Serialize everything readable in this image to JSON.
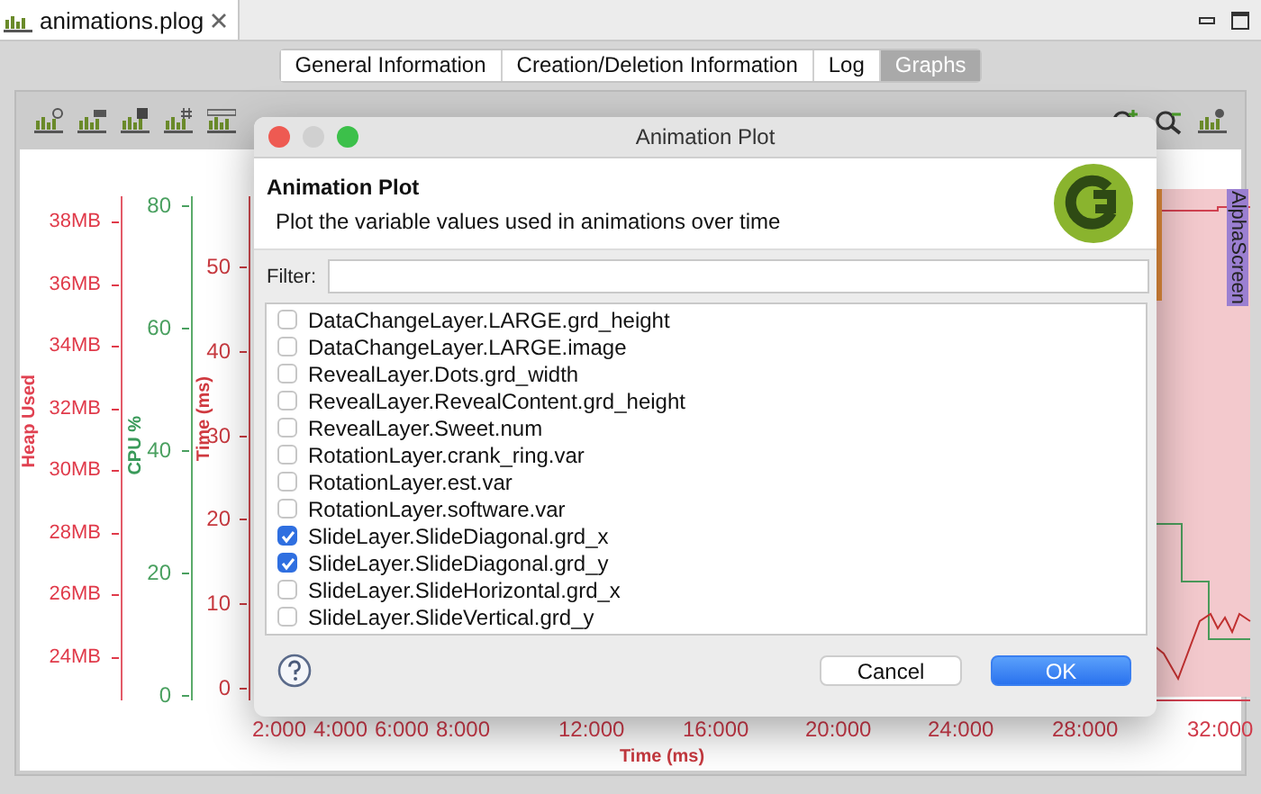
{
  "editor_tab": {
    "label": "animations.plog",
    "selected": true
  },
  "view_tabs": [
    {
      "label": "General Information",
      "selected": false
    },
    {
      "label": "Creation/Deletion Information",
      "selected": false
    },
    {
      "label": "Log",
      "selected": false
    },
    {
      "label": "Graphs",
      "selected": true
    }
  ],
  "chart": {
    "heap_axis": {
      "title": "Heap Used",
      "ticks": [
        "38MB",
        "36MB",
        "34MB",
        "32MB",
        "30MB",
        "28MB",
        "26MB",
        "24MB"
      ]
    },
    "cpu_axis": {
      "title": "CPU %",
      "ticks": [
        "80",
        "60",
        "40",
        "20",
        "0"
      ]
    },
    "time_axis": {
      "title": "Time (ms)",
      "ticks": [
        "50",
        "40",
        "30",
        "20",
        "10",
        "0"
      ]
    },
    "x_axis": {
      "title": "Time (ms)",
      "ticks": [
        "2:000",
        "4:000",
        "6:000",
        "8:000",
        "12:000",
        "16:000",
        "20:000",
        "24:000",
        "28:000",
        "32:000"
      ]
    },
    "marker": {
      "label": "AlphaScreen"
    }
  },
  "dialog": {
    "title": "Animation Plot",
    "heading": "Animation Plot",
    "description": "Plot the variable values used in animations over time",
    "filter_label": "Filter:",
    "variables": [
      {
        "name": "DataChangeLayer.LARGE.grd_height",
        "checked": false
      },
      {
        "name": "DataChangeLayer.LARGE.image",
        "checked": false
      },
      {
        "name": "RevealLayer.Dots.grd_width",
        "checked": false
      },
      {
        "name": "RevealLayer.RevealContent.grd_height",
        "checked": false
      },
      {
        "name": "RevealLayer.Sweet.num",
        "checked": false
      },
      {
        "name": "RotationLayer.crank_ring.var",
        "checked": false
      },
      {
        "name": "RotationLayer.est.var",
        "checked": false
      },
      {
        "name": "RotationLayer.software.var",
        "checked": false
      },
      {
        "name": "SlideLayer.SlideDiagonal.grd_x",
        "checked": true
      },
      {
        "name": "SlideLayer.SlideDiagonal.grd_y",
        "checked": true
      },
      {
        "name": "SlideLayer.SlideHorizontal.grd_x",
        "checked": false
      },
      {
        "name": "SlideLayer.SlideVertical.grd_y",
        "checked": false
      }
    ],
    "buttons": [
      {
        "label": "Cancel",
        "kind": "secondary"
      },
      {
        "label": "OK",
        "kind": "primary"
      }
    ]
  }
}
